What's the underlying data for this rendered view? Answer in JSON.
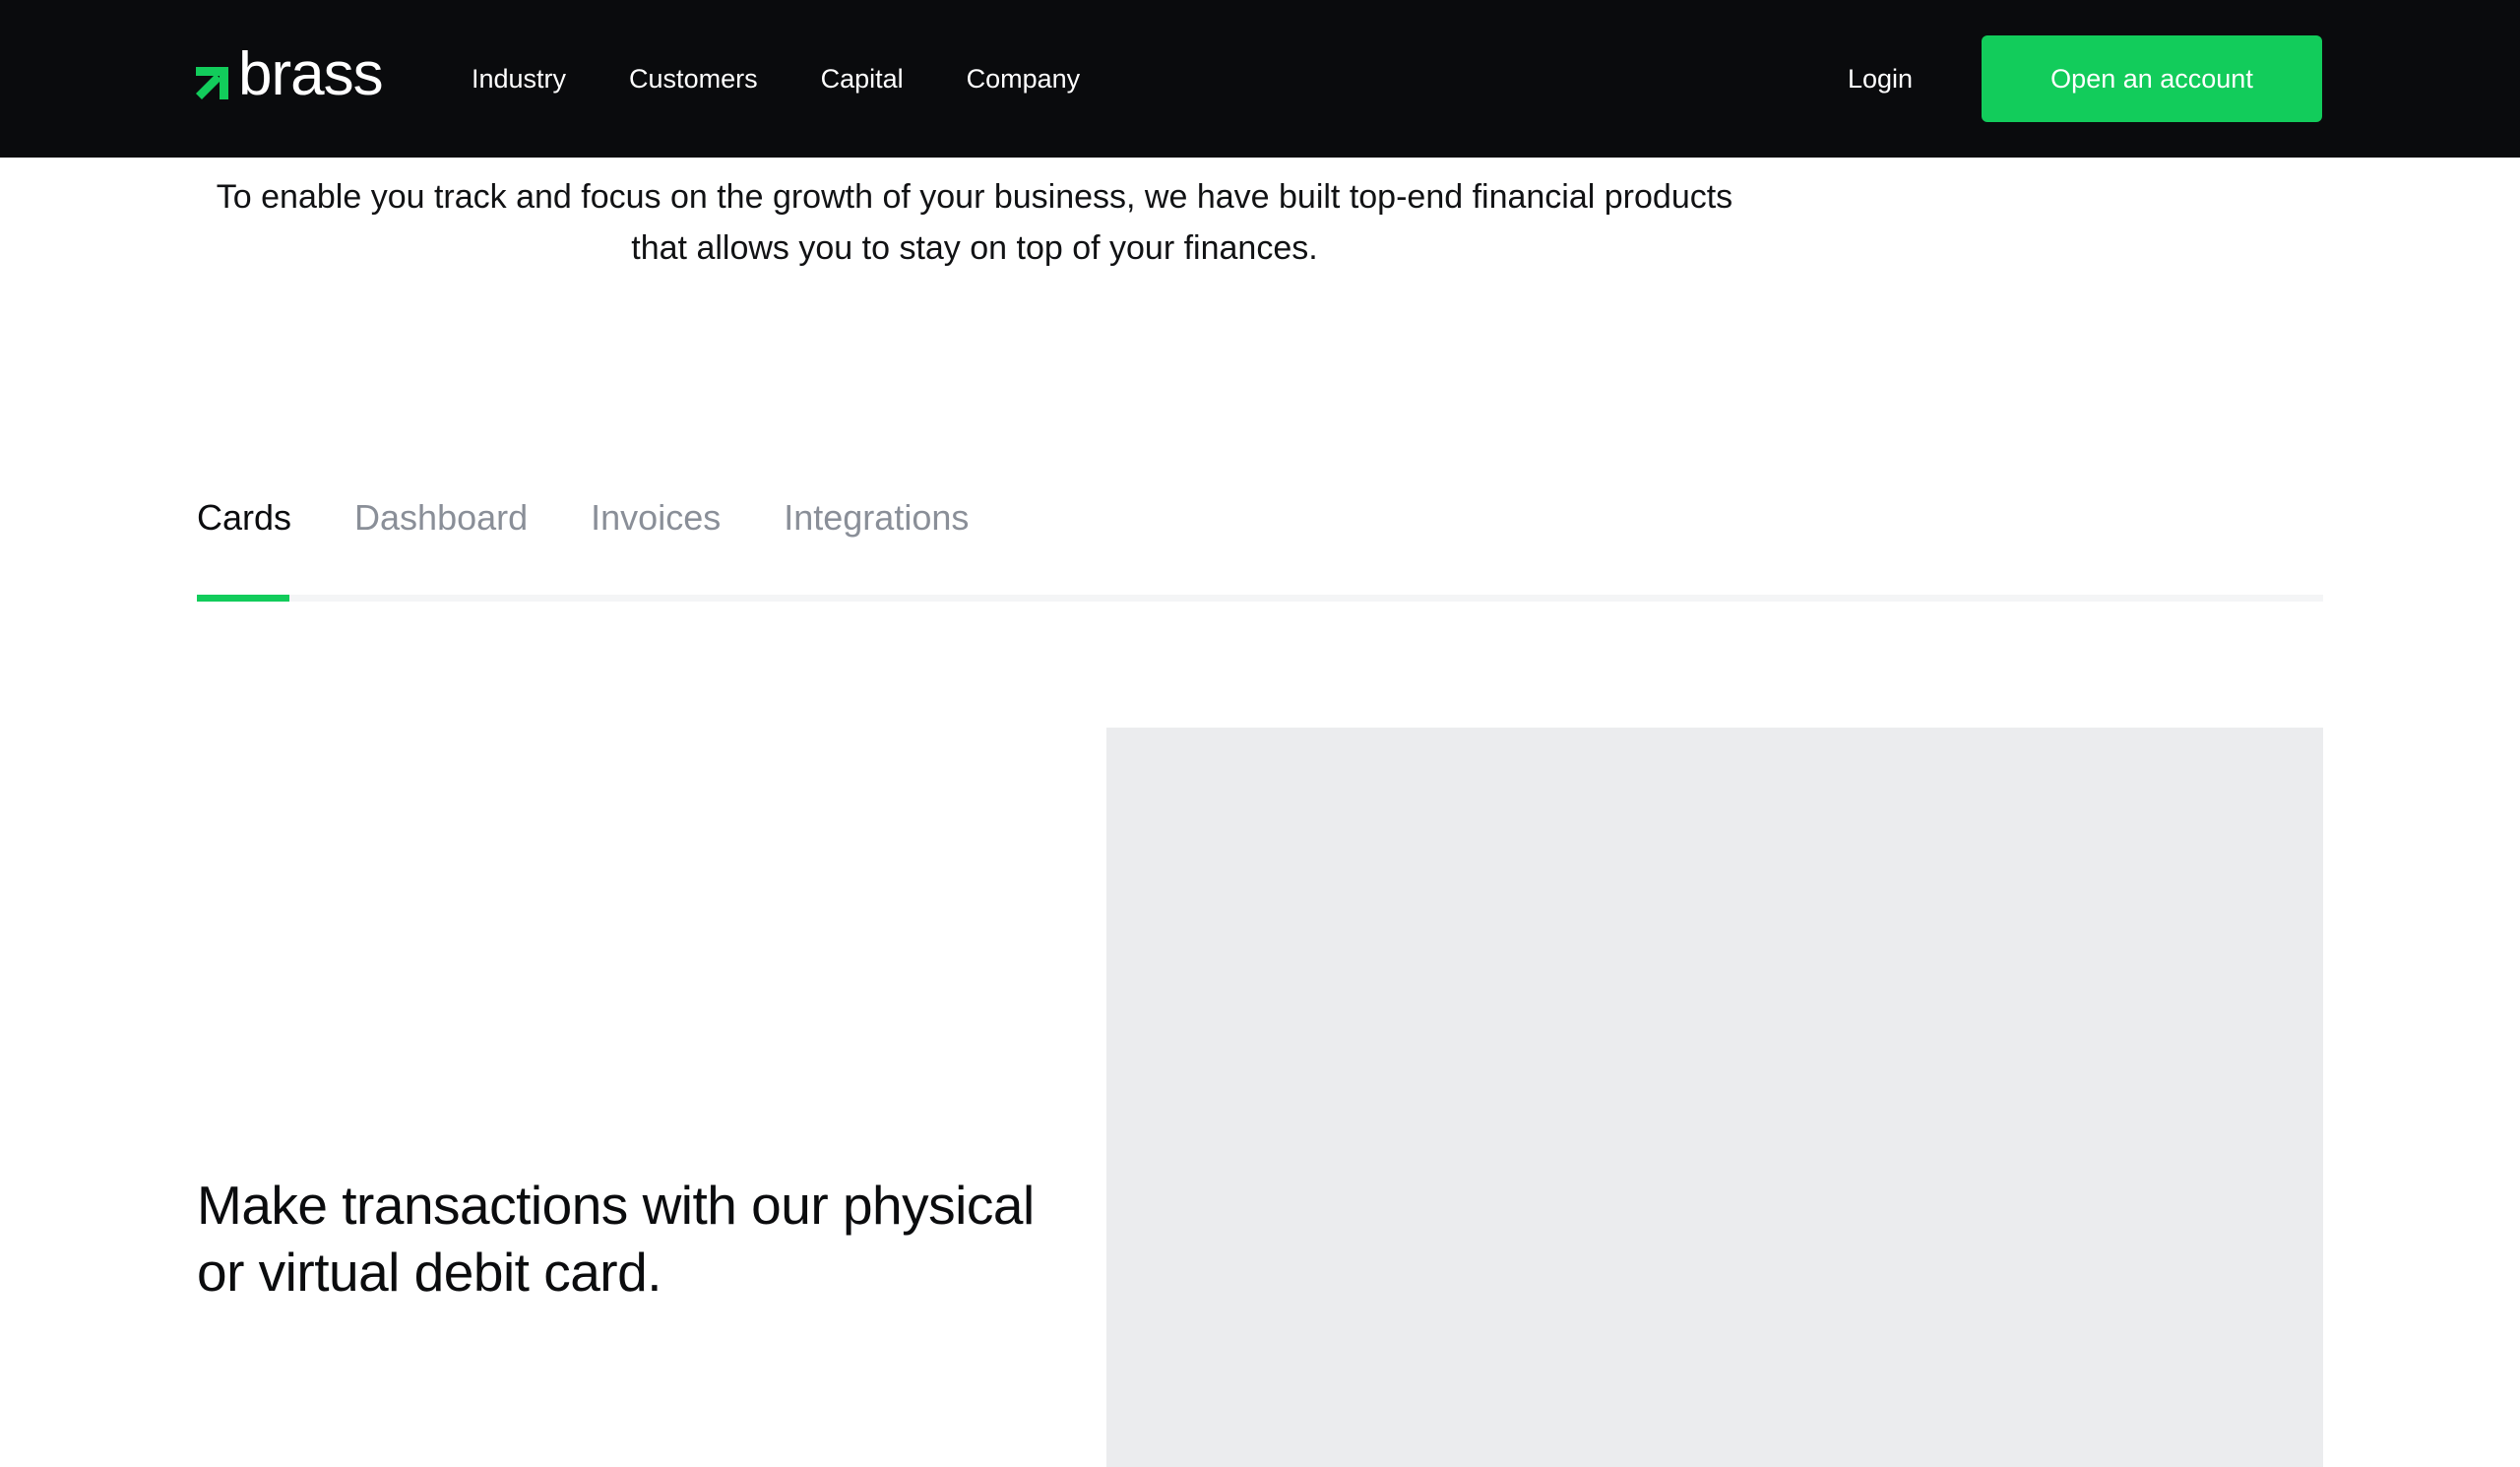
{
  "header": {
    "logo_text": "brass",
    "logo_icon": "arrow-up-right-icon",
    "nav": [
      {
        "label": "Industry"
      },
      {
        "label": "Customers"
      },
      {
        "label": "Capital"
      },
      {
        "label": "Company"
      }
    ],
    "login_label": "Login",
    "cta_label": "Open an account"
  },
  "intro": {
    "text": "To enable you track and focus on the growth of your business, we have built top-end financial products that allows you to stay on top of your finances."
  },
  "tabs": [
    {
      "label": "Cards",
      "active": true
    },
    {
      "label": "Dashboard",
      "active": false
    },
    {
      "label": "Invoices",
      "active": false
    },
    {
      "label": "Integrations",
      "active": false
    }
  ],
  "feature": {
    "heading": "Make transactions with our physical or virtual debit card."
  },
  "colors": {
    "brand_green": "#12cc5b",
    "header_bg": "#0a0b0d",
    "placeholder_gray": "#ebecee",
    "tab_inactive": "#8a8f98"
  }
}
